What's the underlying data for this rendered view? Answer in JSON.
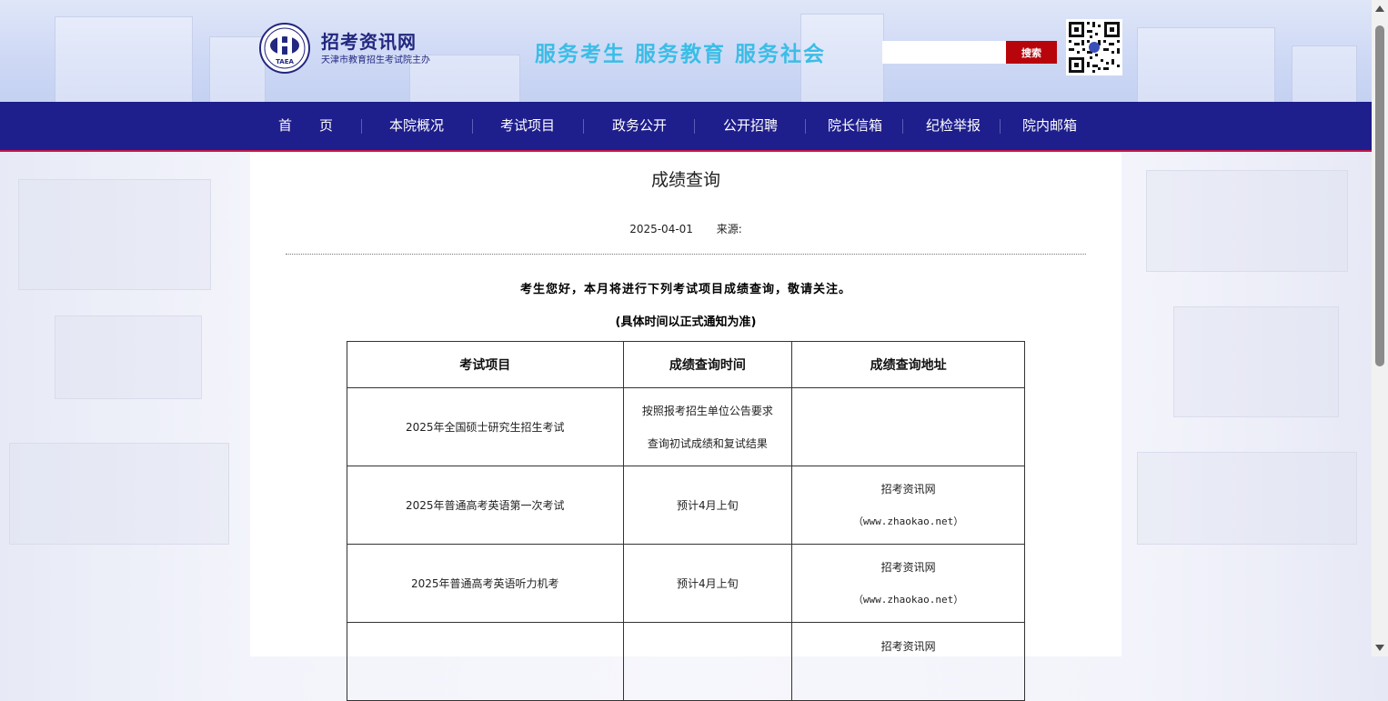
{
  "header": {
    "logo_title": "招考资讯网",
    "logo_subtitle": "天津市教育招生考试院主办",
    "logo_emblem_text": "TAEA",
    "slogan": "服务考生  服务教育  服务社会",
    "search": {
      "placeholder": "",
      "value": "",
      "button_label": "搜索"
    }
  },
  "nav": {
    "items": [
      {
        "label": "首　　页"
      },
      {
        "label": "本院概况"
      },
      {
        "label": "考试项目"
      },
      {
        "label": "政务公开"
      },
      {
        "label": "公开招聘"
      },
      {
        "label": "院长信箱"
      },
      {
        "label": "纪检举报"
      },
      {
        "label": "院内邮箱"
      }
    ]
  },
  "article": {
    "title": "成绩查询",
    "date": "2025-04-01",
    "source_label": "来源:",
    "notice_line1": "考生您好，本月将进行下列考试项目成绩查询，敬请关注。",
    "notice_line2": "(具体时间以正式通知为准)",
    "table": {
      "headers": [
        "考试项目",
        "成绩查询时间",
        "成绩查询地址"
      ],
      "rows": [
        {
          "exam": "2025年全国硕士研究生招生考试",
          "time_line1": "按照报考招生单位公告要求",
          "time_line2": "查询初试成绩和复试结果",
          "addr_line1": "",
          "addr_line2": ""
        },
        {
          "exam": "2025年普通高考英语第一次考试",
          "time_line1": "预计4月上旬",
          "time_line2": "",
          "addr_line1": "招考资讯网",
          "addr_line2": "（www.zhaokao.net）"
        },
        {
          "exam": "2025年普通高考英语听力机考",
          "time_line1": "预计4月上旬",
          "time_line2": "",
          "addr_line1": "招考资讯网",
          "addr_line2": "（www.zhaokao.net）"
        },
        {
          "exam": "",
          "time_line1": "",
          "time_line2": "",
          "addr_line1": "招考资讯网",
          "addr_line2": ""
        }
      ]
    }
  },
  "colors": {
    "nav_bg": "#1e1e8c",
    "nav_underline": "#c4174a",
    "search_button": "#b8050b",
    "slogan": "#3bbde6",
    "logo_text": "#23277f"
  },
  "icons": {
    "logo": "taea-emblem-icon",
    "qr": "qr-code-icon",
    "scroll_up": "scroll-up-arrow-icon",
    "scroll_down": "scroll-down-arrow-icon"
  }
}
